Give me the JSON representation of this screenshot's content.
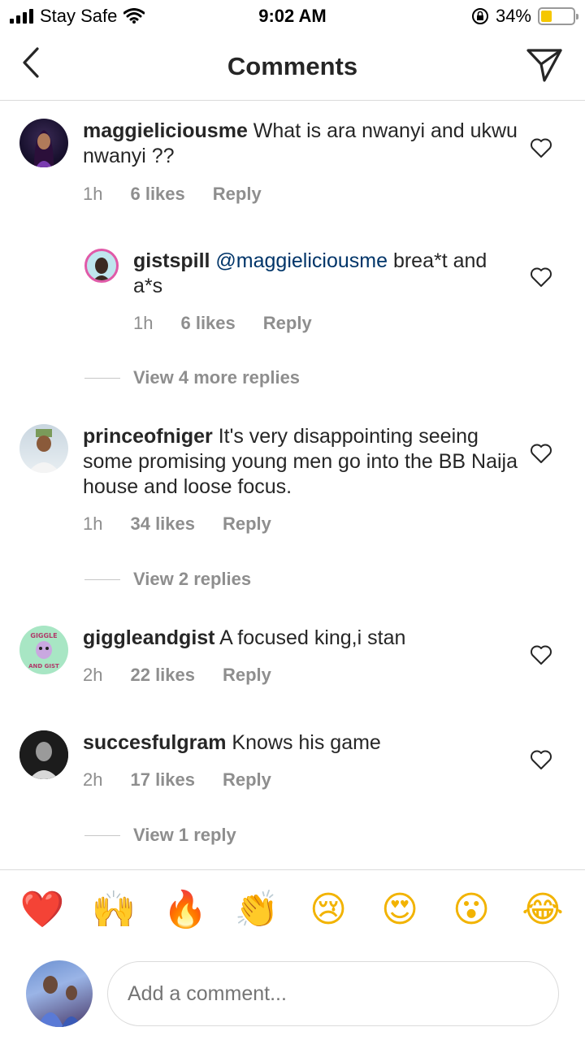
{
  "status_bar": {
    "carrier": "Stay Safe",
    "time": "9:02 AM",
    "battery": "34%",
    "battery_level": 0.34
  },
  "header": {
    "title": "Comments"
  },
  "comments": [
    {
      "username": "maggieliciousme",
      "text": " What is ara nwanyi and ukwu nwanyi ??",
      "time": "1h",
      "likes": "6 likes",
      "reply": "Reply",
      "replies": [
        {
          "username": "gistspill",
          "mention": "@maggieliciousme",
          "text": " brea*t and a*s",
          "time": "1h",
          "likes": "6 likes",
          "reply": "Reply"
        }
      ],
      "view_more": "View 4 more replies"
    },
    {
      "username": "princeofniger",
      "text": " It's very disappointing seeing some promising young men go into the BB Naija house  and loose focus.",
      "time": "1h",
      "likes": "34 likes",
      "reply": "Reply",
      "view_more": "View 2 replies"
    },
    {
      "username": "giggleandgist",
      "text": " A focused king,i stan",
      "time": "2h",
      "likes": "22 likes",
      "reply": "Reply"
    },
    {
      "username": "succesfulgram",
      "text": " Knows his game",
      "time": "2h",
      "likes": "17 likes",
      "reply": "Reply",
      "view_more": "View 1 reply"
    }
  ],
  "avatar_labels": {
    "giggleandgist_top": "GIGGLE",
    "giggleandgist_bottom": "AND GIST"
  },
  "emoji_bar": [
    "❤️",
    "🙌",
    "🔥",
    "👏",
    "😢",
    "😍",
    "😮",
    "😂"
  ],
  "composer": {
    "placeholder": "Add a comment..."
  }
}
